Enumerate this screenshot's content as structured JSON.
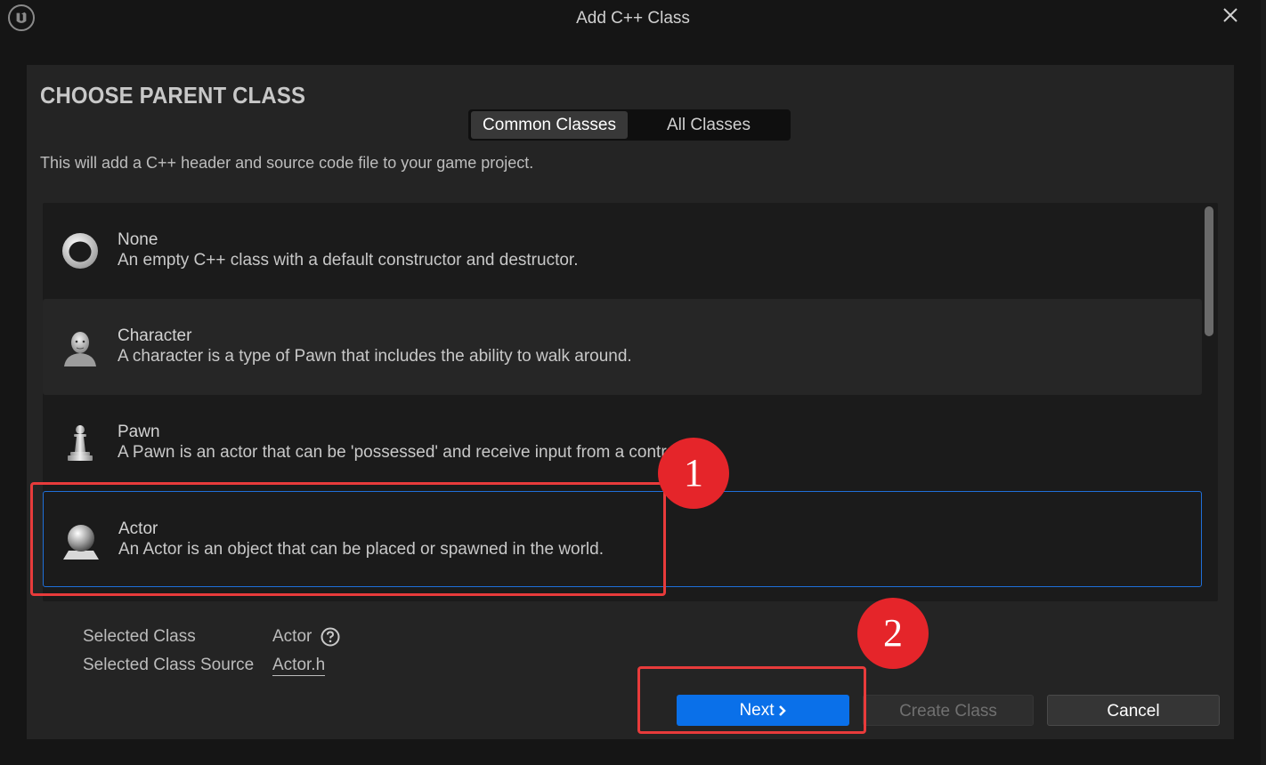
{
  "window": {
    "title": "Add C++ Class"
  },
  "heading": "CHOOSE PARENT CLASS",
  "tabs": [
    {
      "label": "Common Classes",
      "active": true
    },
    {
      "label": "All Classes",
      "active": false
    }
  ],
  "description": "This will add a C++ header and source code file to your game project.",
  "classes": [
    {
      "name": "None",
      "description": "An empty C++ class with a default constructor and destructor.",
      "icon": "none-ring-icon"
    },
    {
      "name": "Character",
      "description": "A character is a type of Pawn that includes the ability to walk around.",
      "icon": "character-icon"
    },
    {
      "name": "Pawn",
      "description": "A Pawn is an actor that can be 'possessed' and receive input from a controller.",
      "icon": "pawn-icon"
    },
    {
      "name": "Actor",
      "description": "An Actor is an object that can be placed or spawned in the world.",
      "icon": "actor-sphere-icon",
      "selected": true
    }
  ],
  "selection": {
    "class_label": "Selected Class",
    "class_value": "Actor",
    "source_label": "Selected Class Source",
    "source_value": "Actor.h"
  },
  "buttons": {
    "next": "Next",
    "create": "Create Class",
    "cancel": "Cancel"
  },
  "annotations": [
    "1",
    "2"
  ],
  "colors": {
    "accent": "#0a70e9",
    "selection_border": "#1f6fd8",
    "annotation": "#e5252a"
  }
}
